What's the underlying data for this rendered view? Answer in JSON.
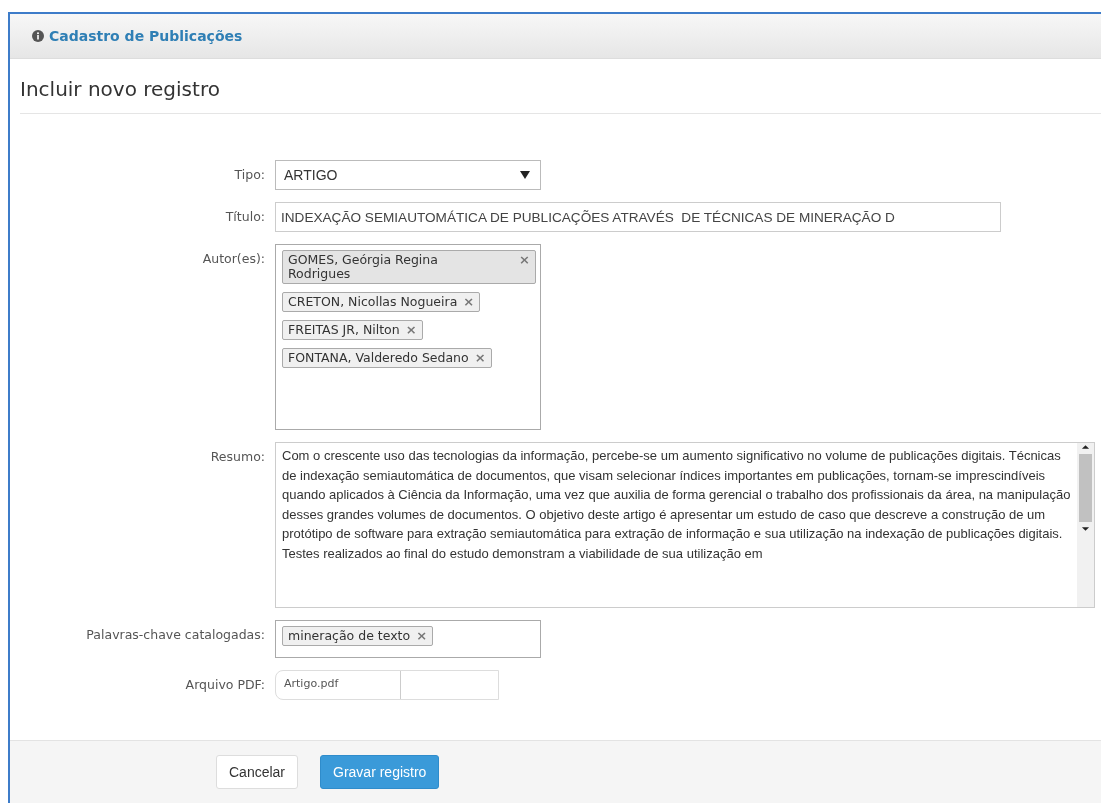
{
  "header": {
    "title": "Cadastro de Publicações"
  },
  "page_title": "Incluir novo registro",
  "form": {
    "tipo": {
      "label": "Tipo:",
      "value": "ARTIGO"
    },
    "titulo": {
      "label": "Título:",
      "value": "INDEXAÇÃO SEMIAUTOMÁTICA DE PUBLICAÇÕES ATRAVÉS  DE TÉCNICAS DE MINERAÇÃO D"
    },
    "autores": {
      "label": "Autor(es):",
      "tags": [
        {
          "text": "GOMES, Geórgia Regina Rodrigues",
          "remove": "×",
          "highlighted": true
        },
        {
          "text": "CRETON, Nicollas Nogueira",
          "remove": "×",
          "highlighted": false
        },
        {
          "text": "FREITAS JR, Nilton",
          "remove": "×",
          "highlighted": false
        },
        {
          "text": "FONTANA, Valderedo Sedano",
          "remove": "×",
          "highlighted": false
        }
      ]
    },
    "resumo": {
      "label": "Resumo:",
      "value": "Com o crescente uso das tecnologias da informação, percebe-se um aumento significativo no volume de publicações digitais. Técnicas de indexação semiautomática de documentos, que visam selecionar índices importantes em publicações, tornam-se imprescindíveis quando aplicados à Ciência da Informação, uma vez que auxilia de forma gerencial o trabalho dos profissionais da área, na manipulação desses grandes volumes de documentos. O objetivo deste artigo é apresentar um estudo de caso que descreve a construção de um protótipo de software para extração semiautomática para extração de informação e sua utilização na indexação de publicações digitais. Testes realizados ao final do estudo demonstram a viabilidade de sua utilização em"
    },
    "palavras": {
      "label": "Palavras-chave catalogadas:",
      "tags": [
        {
          "text": "mineração de texto",
          "remove": "×",
          "highlighted": false
        }
      ]
    },
    "arquivo": {
      "label": "Arquivo PDF:",
      "value": "Artigo.pdf"
    }
  },
  "buttons": [
    {
      "label": "Cancelar",
      "kind": "default"
    },
    {
      "label": "Gravar registro",
      "kind": "primary"
    }
  ]
}
